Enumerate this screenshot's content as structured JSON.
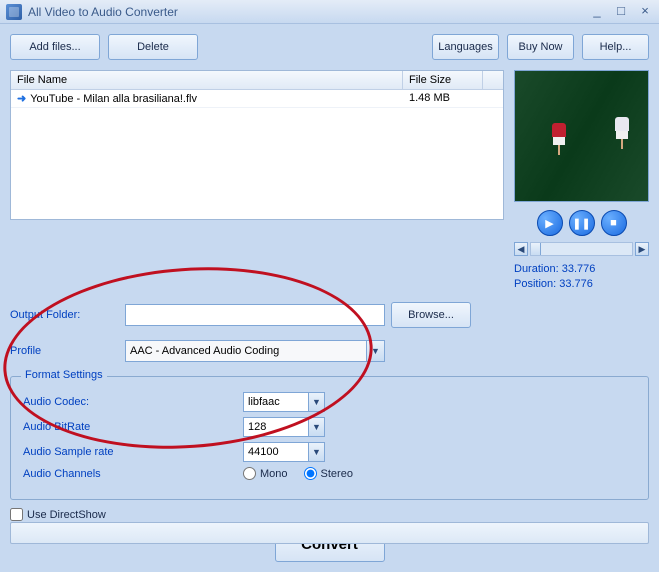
{
  "window": {
    "title": "All Video to Audio Converter"
  },
  "toolbar": {
    "add_files": "Add files...",
    "delete": "Delete",
    "languages": "Languages",
    "buy_now": "Buy Now",
    "help": "Help..."
  },
  "table": {
    "col_filename": "File Name",
    "col_filesize": "File Size",
    "rows": [
      {
        "name": "YouTube - Milan alla brasiliana!.flv",
        "size": "1.48 MB"
      }
    ]
  },
  "output": {
    "label": "Output Folder:",
    "value": "",
    "browse": "Browse..."
  },
  "profile": {
    "label": "Profile",
    "value": "AAC - Advanced Audio Coding"
  },
  "preview": {
    "duration_label": "Duration:",
    "duration": "33.776",
    "position_label": "Position:",
    "position": "33.776"
  },
  "format": {
    "legend": "Format Settings",
    "codec_label": "Audio Codec:",
    "codec": "libfaac",
    "bitrate_label": "Audio BitRate",
    "bitrate": "128",
    "samplerate_label": "Audio Sample rate",
    "samplerate": "44100",
    "channels_label": "Audio Channels",
    "mono": "Mono",
    "stereo": "Stereo"
  },
  "directshow": "Use DirectShow",
  "convert": "Convert"
}
